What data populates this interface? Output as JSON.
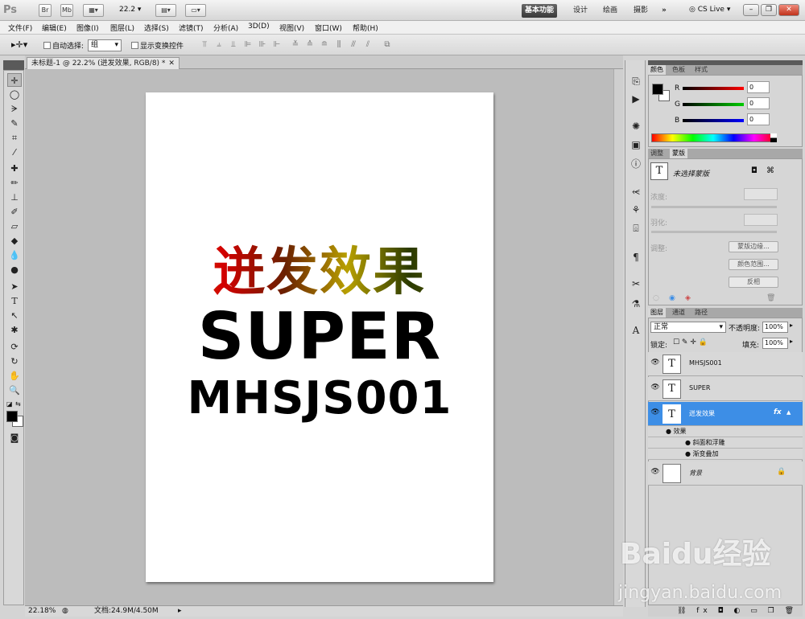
{
  "app": {
    "logo": "Ps",
    "zoom": "22.2",
    "workspaces": [
      "基本功能",
      "设计",
      "绘画",
      "摄影"
    ],
    "active_workspace": "基本功能",
    "cslive": "CS Live"
  },
  "menu": [
    "文件(F)",
    "编辑(E)",
    "图像(I)",
    "图层(L)",
    "选择(S)",
    "滤镜(T)",
    "分析(A)",
    "3D(D)",
    "视图(V)",
    "窗口(W)",
    "帮助(H)"
  ],
  "options": {
    "auto_select_label": "自动选择:",
    "auto_select_value": "组",
    "show_transform_label": "显示变换控件"
  },
  "document": {
    "tab_title": "未标题-1 @ 22.2% (迸发效果, RGB/8) *",
    "text_cn": "迸发效果",
    "text_super": "SUPER",
    "text_code": "MHSJS001"
  },
  "status": {
    "zoom": "22.18%",
    "doc": "文档:24.9M/4.50M"
  },
  "color_panel": {
    "tabs": [
      "颜色",
      "色板",
      "样式"
    ],
    "r_label": "R",
    "g_label": "G",
    "b_label": "B",
    "r": "0",
    "g": "0",
    "b": "0"
  },
  "mask_panel": {
    "tabs": [
      "调整",
      "蒙版"
    ],
    "selection_label": "未选择蒙版",
    "density_label": "浓度:",
    "feather_label": "羽化:",
    "refine_label": "调整:",
    "btn_edge": "蒙版边缘...",
    "btn_range": "颜色范围...",
    "btn_invert": "反相"
  },
  "layers_panel": {
    "tabs": [
      "图层",
      "通道",
      "路径"
    ],
    "blend_mode": "正常",
    "opacity_label": "不透明度:",
    "opacity": "100%",
    "lock_label": "锁定:",
    "fill_label": "填充:",
    "fill": "100%",
    "layers": [
      {
        "name": "MHSJS001"
      },
      {
        "name": "SUPER"
      },
      {
        "name": "迸发效果"
      },
      {
        "name": "背景"
      }
    ],
    "effects_label": "效果",
    "effects": [
      "斜面和浮雕",
      "渐变叠加"
    ],
    "fx": "fx"
  },
  "watermark": {
    "brand": "Baidu经验",
    "url": "jingyan.baidu.com"
  },
  "colors": {
    "accent": "#3d8ee6",
    "workspace_active": "#444444"
  }
}
